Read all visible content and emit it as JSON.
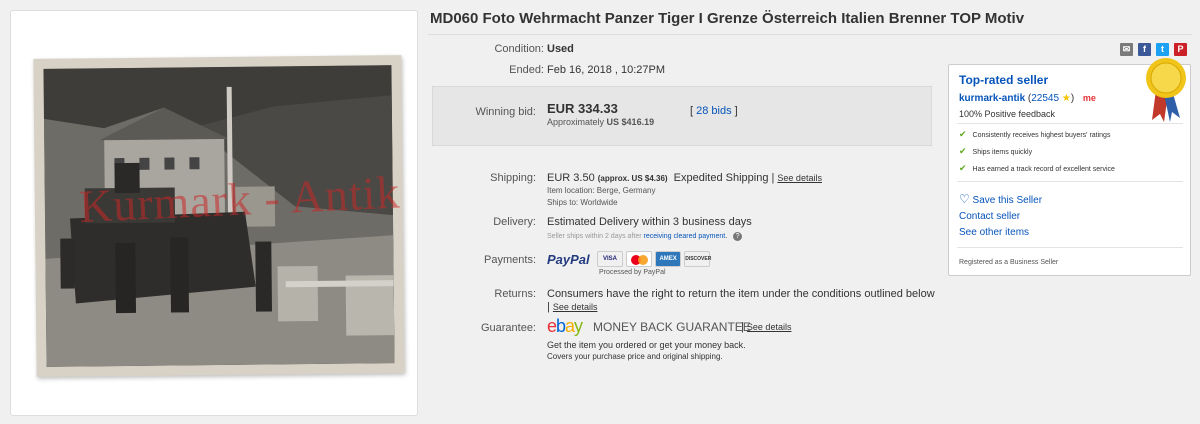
{
  "photo": {
    "watermark": "Kurmark - Antik"
  },
  "title": "MD060 Foto Wehrmacht Panzer Tiger I Grenze Österreich Italien Brenner TOP Motiv",
  "condition": {
    "label": "Condition:",
    "value": "Used"
  },
  "ended": {
    "label": "Ended:",
    "value": "Feb 16, 2018 , 10:27PM"
  },
  "bid": {
    "label": "Winning bid:",
    "price": "EUR 334.33",
    "approx_prefix": "Approximately",
    "approx_value": "US $416.19",
    "bids": "28 bids"
  },
  "shipping": {
    "label": "Shipping:",
    "price": "EUR 3.50",
    "approx": "(approx. US $4.36)",
    "method": "Expedited Shipping",
    "see_details": "See details",
    "location": "Item location:  Berge, Germany",
    "ships_to": "Ships to:  Worldwide"
  },
  "delivery": {
    "label": "Delivery:",
    "value": "Estimated Delivery within 3 business days",
    "note_prefix": "Seller ships within 2 days after",
    "note_link": "receiving cleared payment",
    "note_suffix": "."
  },
  "payments": {
    "label": "Payments:",
    "paypal": "PayPal",
    "processed": "Processed by PayPal",
    "cards": [
      "VISA",
      "MC",
      "AMEX",
      "DISCOVER"
    ]
  },
  "returns": {
    "label": "Returns:",
    "value": "Consumers have the right to return the item under the conditions outlined below",
    "see_details": "See details"
  },
  "guarantee": {
    "label": "Guarantee:",
    "brand": "ebay",
    "name": "MONEY BACK GUARANTEE",
    "see_details": "See details",
    "line1": "Get the item you ordered or get your money back.",
    "line2": "Covers your purchase price and original shipping."
  },
  "seller": {
    "badge": "Top-rated seller",
    "name": "kurmark-antik",
    "score": "22545",
    "me": "me",
    "feedback": "100% Positive feedback",
    "features": [
      "Consistently receives highest buyers' ratings",
      "Ships items quickly",
      "Has earned a track record of excellent service"
    ],
    "save": "Save this Seller",
    "contact": "Contact seller",
    "other": "See other items",
    "registered": "Registered as a Business Seller"
  },
  "colors": {
    "link": "#0654ba",
    "check": "#5ba71b",
    "star": "#f5c400"
  }
}
